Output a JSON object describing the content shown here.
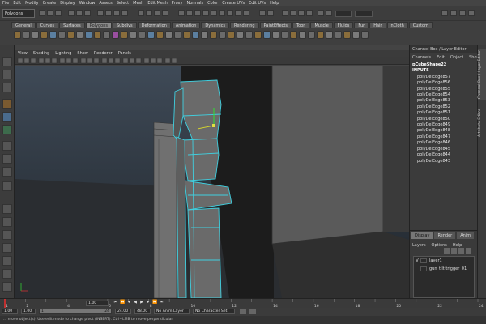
{
  "menubar": {
    "items": [
      "File",
      "Edit",
      "Modify",
      "Create",
      "Display",
      "Window",
      "Assets",
      "Select",
      "Mesh",
      "Edit Mesh",
      "Proxy",
      "Normals",
      "Color",
      "Create UVs",
      "Edit UVs",
      "Help"
    ]
  },
  "statusline": {
    "mode": "Polygons"
  },
  "shelf": {
    "tabs": [
      "General",
      "Curves",
      "Surfaces",
      "Polygons",
      "Subdivs",
      "Deformation",
      "Animation",
      "Dynamics",
      "Rendering",
      "PaintEffects",
      "Toon",
      "Muscle",
      "Fluids",
      "Fur",
      "Hair",
      "nCloth",
      "Custom"
    ],
    "active_tab": "Polygons"
  },
  "panel": {
    "menus": [
      "View",
      "Shading",
      "Lighting",
      "Show",
      "Renderer",
      "Panels"
    ]
  },
  "channel_box": {
    "title": "Channel Box / Layer Editor",
    "menus": [
      "Channels",
      "Edit",
      "Object",
      "Show"
    ],
    "object": "pCubeShape22",
    "inputs_label": "INPUTS",
    "inputs": [
      "polyDelEdge857",
      "polyDelEdge856",
      "polyDelEdge855",
      "polyDelEdge854",
      "polyDelEdge853",
      "polyDelEdge852",
      "polyDelEdge851",
      "polyDelEdge850",
      "polyDelEdge849",
      "polyDelEdge848",
      "polyDelEdge847",
      "polyDelEdge846",
      "polyDelEdge845",
      "polyDelEdge844",
      "polyDelEdge843"
    ]
  },
  "layer_editor": {
    "tabs": [
      "Display",
      "Render",
      "Anim"
    ],
    "active_tab": "Display",
    "menus": [
      "Layers",
      "Options",
      "Help"
    ],
    "layers": [
      {
        "vis": "V",
        "name": "layer1"
      },
      {
        "vis": "",
        "name": "gun_tilt:trigger_01"
      }
    ]
  },
  "side_tabs": [
    "Channel Box / Layer Editor",
    "Attribute Editor"
  ],
  "time_slider": {
    "ticks": [
      "1",
      "2",
      "4",
      "6",
      "8",
      "10",
      "12",
      "14",
      "16",
      "18",
      "20",
      "22",
      "24"
    ],
    "current_frame": "1.00"
  },
  "range": {
    "start": "1.00",
    "inner_start": "1.00",
    "range_start_label": "1",
    "range_end_label": "24",
    "end": "24.00",
    "anim_end": "48.00",
    "anim_layer": "No Anim Layer",
    "char_set": "No Character Set"
  },
  "help": {
    "text": "... move object(s). Use edit mode to change pivot (INSERT). Ctrl+LMB to move perpendicular"
  },
  "colors": {
    "selection": "#40d0e0",
    "viewport_bg": "#4d4d4d"
  }
}
